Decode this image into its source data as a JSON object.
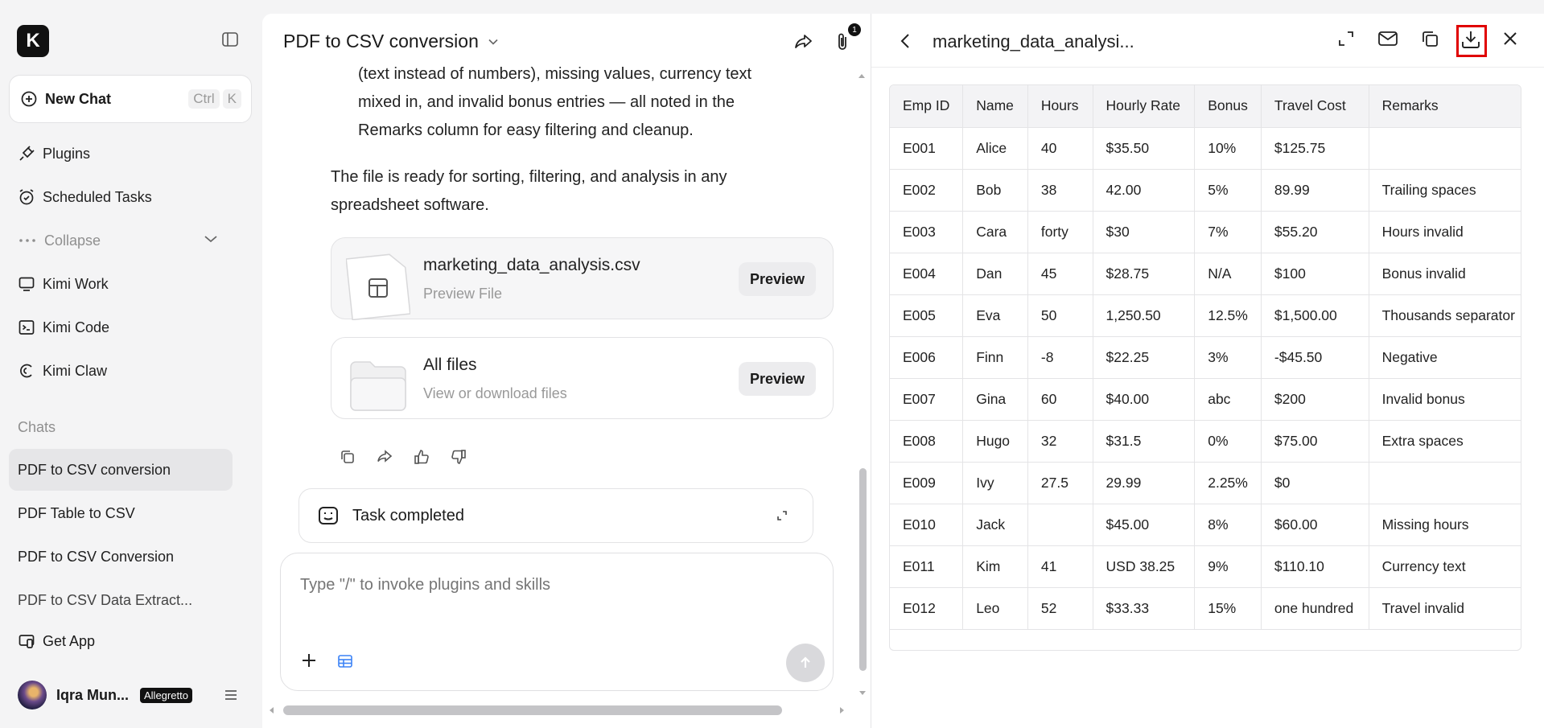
{
  "sidebar": {
    "logo": "K",
    "new_chat": {
      "label": "New Chat",
      "kbd1": "Ctrl",
      "kbd2": "K"
    },
    "nav": [
      {
        "label": "Plugins",
        "icon": "plug-icon"
      },
      {
        "label": "Scheduled Tasks",
        "icon": "alarm-icon"
      },
      {
        "label": "Collapse",
        "icon": "dots-icon"
      },
      {
        "label": "Kimi Work",
        "icon": "monitor-icon"
      },
      {
        "label": "Kimi Code",
        "icon": "terminal-icon"
      },
      {
        "label": "Kimi Claw",
        "icon": "claw-icon"
      }
    ],
    "chats_header": "Chats",
    "chats": [
      "PDF to CSV conversion",
      "PDF Table to CSV",
      "PDF to CSV Conversion",
      "PDF to CSV Data Extract..."
    ],
    "get_app": "Get App",
    "user": {
      "name": "Iqra Mun...",
      "badge": "Allegretto"
    }
  },
  "chat": {
    "title": "PDF to CSV conversion",
    "attachments_count": "1",
    "msg_line1": "(text instead of numbers), missing values, currency text",
    "msg_line2": "mixed in, and invalid bonus entries — all noted in the",
    "msg_line3": "Remarks column for easy filtering and cleanup.",
    "msg2_line1": "The file is ready for sorting, filtering, and analysis in any",
    "msg2_line2": "spreadsheet software.",
    "file_card": {
      "name": "marketing_data_analysis.csv",
      "sub": "Preview File",
      "button": "Preview"
    },
    "all_files": {
      "name": "All files",
      "sub": "View or download files",
      "button": "Preview"
    },
    "task": "Task completed",
    "composer_placeholder": "Type \"/\" to invoke plugins and skills"
  },
  "preview": {
    "title": "marketing_data_analysi...",
    "columns": [
      "Emp ID",
      "Name",
      "Hours",
      "Hourly Rate",
      "Bonus",
      "Travel Cost",
      "Remarks"
    ],
    "rows": [
      [
        "E001",
        "Alice",
        "40",
        "$35.50",
        "10%",
        "$125.75",
        ""
      ],
      [
        "E002",
        "Bob",
        "38",
        "42.00",
        "5%",
        "89.99",
        "Trailing spaces"
      ],
      [
        "E003",
        "Cara",
        "forty",
        "$30",
        "7%",
        "$55.20",
        "Hours invalid"
      ],
      [
        "E004",
        "Dan",
        "45",
        "$28.75",
        "N/A",
        "$100",
        "Bonus invalid"
      ],
      [
        "E005",
        "Eva",
        "50",
        "1,250.50",
        "12.5%",
        "$1,500.00",
        "Thousands separator"
      ],
      [
        "E006",
        "Finn",
        "-8",
        "$22.25",
        "3%",
        "-$45.50",
        "Negative"
      ],
      [
        "E007",
        "Gina",
        "60",
        "$40.00",
        "abc",
        "$200",
        "Invalid bonus"
      ],
      [
        "E008",
        "Hugo",
        "32",
        "$31.5",
        "0%",
        "$75.00",
        "Extra spaces"
      ],
      [
        "E009",
        "Ivy",
        "27.5",
        "29.99",
        "2.25%",
        "$0",
        ""
      ],
      [
        "E010",
        "Jack",
        "",
        "$45.00",
        "8%",
        "$60.00",
        "Missing hours"
      ],
      [
        "E011",
        "Kim",
        "41",
        "USD 38.25",
        "9%",
        "$110.10",
        "Currency text"
      ],
      [
        "E012",
        "Leo",
        "52",
        "$33.33",
        "15%",
        "one hundred",
        "Travel invalid"
      ]
    ]
  },
  "colors": {
    "highlight": "#e00000",
    "sidebar_bg": "#f4f4f5",
    "panel_bg": "#ffffff"
  }
}
